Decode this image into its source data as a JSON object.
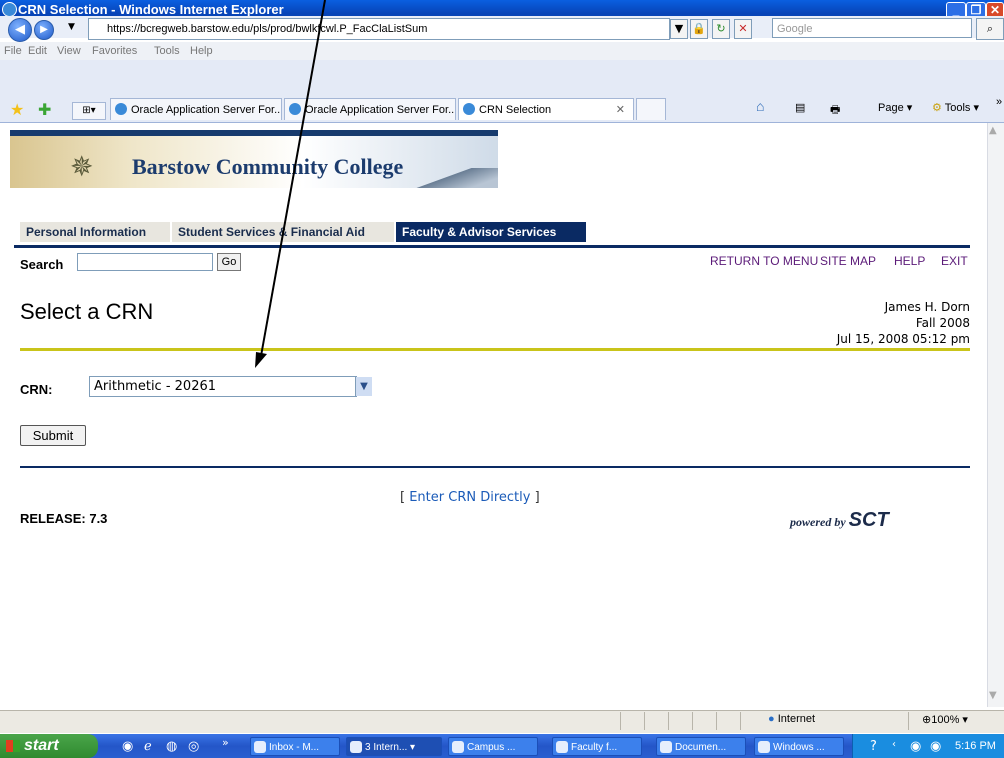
{
  "window": {
    "title": "CRN Selection - Windows Internet Explorer",
    "address": "https://bcregweb.barstow.edu/pls/prod/bwlkfcwl.P_FacClaListSum",
    "search_placeholder": "Google",
    "menu": [
      "File",
      "Edit",
      "View",
      "Favorites",
      "Tools",
      "Help"
    ],
    "tabs": [
      {
        "label": "Oracle Application Server For..."
      },
      {
        "label": "Oracle Application Server For..."
      },
      {
        "label": "CRN Selection"
      }
    ],
    "commands": {
      "page": "Page",
      "tools": "Tools"
    }
  },
  "site": {
    "banner_title": "Barstow Community College",
    "main_tabs": [
      "Personal Information",
      "Student Services & Financial Aid",
      "Faculty & Advisor Services"
    ],
    "search_label": "Search",
    "go_label": "Go",
    "top_links": [
      "RETURN TO MENU",
      "SITE MAP",
      "HELP",
      "EXIT"
    ]
  },
  "page": {
    "title": "Select a CRN",
    "user_name": "James H. Dorn",
    "term": "Fall 2008",
    "datetime": "Jul 15, 2008 05:12 pm",
    "crn_label": "CRN:",
    "crn_selected": "Arithmetic - 20261",
    "submit_label": "Submit",
    "enter_crn_link": "Enter CRN Directly",
    "release": "RELEASE: 7.3",
    "powered_by": "powered by",
    "powered_logo": "SCT"
  },
  "statusbar": {
    "zone": "Internet",
    "zoom": "100%"
  },
  "taskbar": {
    "start": "start",
    "tasks": [
      "Inbox - M...",
      "3 Intern...",
      "Campus ...",
      "Faculty f...",
      "Documen...",
      "Windows ..."
    ],
    "clock": "5:16 PM"
  }
}
